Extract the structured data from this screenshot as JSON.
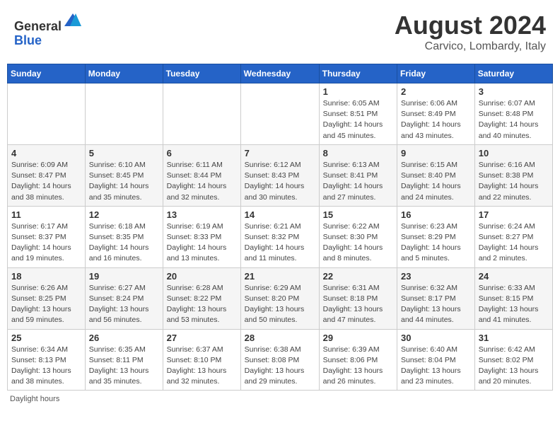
{
  "header": {
    "logo_line1": "General",
    "logo_line2": "Blue",
    "main_title": "August 2024",
    "subtitle": "Carvico, Lombardy, Italy"
  },
  "days_of_week": [
    "Sunday",
    "Monday",
    "Tuesday",
    "Wednesday",
    "Thursday",
    "Friday",
    "Saturday"
  ],
  "weeks": [
    [
      {
        "day": "",
        "detail": ""
      },
      {
        "day": "",
        "detail": ""
      },
      {
        "day": "",
        "detail": ""
      },
      {
        "day": "",
        "detail": ""
      },
      {
        "day": "1",
        "detail": "Sunrise: 6:05 AM\nSunset: 8:51 PM\nDaylight: 14 hours\nand 45 minutes."
      },
      {
        "day": "2",
        "detail": "Sunrise: 6:06 AM\nSunset: 8:49 PM\nDaylight: 14 hours\nand 43 minutes."
      },
      {
        "day": "3",
        "detail": "Sunrise: 6:07 AM\nSunset: 8:48 PM\nDaylight: 14 hours\nand 40 minutes."
      }
    ],
    [
      {
        "day": "4",
        "detail": "Sunrise: 6:09 AM\nSunset: 8:47 PM\nDaylight: 14 hours\nand 38 minutes."
      },
      {
        "day": "5",
        "detail": "Sunrise: 6:10 AM\nSunset: 8:45 PM\nDaylight: 14 hours\nand 35 minutes."
      },
      {
        "day": "6",
        "detail": "Sunrise: 6:11 AM\nSunset: 8:44 PM\nDaylight: 14 hours\nand 32 minutes."
      },
      {
        "day": "7",
        "detail": "Sunrise: 6:12 AM\nSunset: 8:43 PM\nDaylight: 14 hours\nand 30 minutes."
      },
      {
        "day": "8",
        "detail": "Sunrise: 6:13 AM\nSunset: 8:41 PM\nDaylight: 14 hours\nand 27 minutes."
      },
      {
        "day": "9",
        "detail": "Sunrise: 6:15 AM\nSunset: 8:40 PM\nDaylight: 14 hours\nand 24 minutes."
      },
      {
        "day": "10",
        "detail": "Sunrise: 6:16 AM\nSunset: 8:38 PM\nDaylight: 14 hours\nand 22 minutes."
      }
    ],
    [
      {
        "day": "11",
        "detail": "Sunrise: 6:17 AM\nSunset: 8:37 PM\nDaylight: 14 hours\nand 19 minutes."
      },
      {
        "day": "12",
        "detail": "Sunrise: 6:18 AM\nSunset: 8:35 PM\nDaylight: 14 hours\nand 16 minutes."
      },
      {
        "day": "13",
        "detail": "Sunrise: 6:19 AM\nSunset: 8:33 PM\nDaylight: 14 hours\nand 13 minutes."
      },
      {
        "day": "14",
        "detail": "Sunrise: 6:21 AM\nSunset: 8:32 PM\nDaylight: 14 hours\nand 11 minutes."
      },
      {
        "day": "15",
        "detail": "Sunrise: 6:22 AM\nSunset: 8:30 PM\nDaylight: 14 hours\nand 8 minutes."
      },
      {
        "day": "16",
        "detail": "Sunrise: 6:23 AM\nSunset: 8:29 PM\nDaylight: 14 hours\nand 5 minutes."
      },
      {
        "day": "17",
        "detail": "Sunrise: 6:24 AM\nSunset: 8:27 PM\nDaylight: 14 hours\nand 2 minutes."
      }
    ],
    [
      {
        "day": "18",
        "detail": "Sunrise: 6:26 AM\nSunset: 8:25 PM\nDaylight: 13 hours\nand 59 minutes."
      },
      {
        "day": "19",
        "detail": "Sunrise: 6:27 AM\nSunset: 8:24 PM\nDaylight: 13 hours\nand 56 minutes."
      },
      {
        "day": "20",
        "detail": "Sunrise: 6:28 AM\nSunset: 8:22 PM\nDaylight: 13 hours\nand 53 minutes."
      },
      {
        "day": "21",
        "detail": "Sunrise: 6:29 AM\nSunset: 8:20 PM\nDaylight: 13 hours\nand 50 minutes."
      },
      {
        "day": "22",
        "detail": "Sunrise: 6:31 AM\nSunset: 8:18 PM\nDaylight: 13 hours\nand 47 minutes."
      },
      {
        "day": "23",
        "detail": "Sunrise: 6:32 AM\nSunset: 8:17 PM\nDaylight: 13 hours\nand 44 minutes."
      },
      {
        "day": "24",
        "detail": "Sunrise: 6:33 AM\nSunset: 8:15 PM\nDaylight: 13 hours\nand 41 minutes."
      }
    ],
    [
      {
        "day": "25",
        "detail": "Sunrise: 6:34 AM\nSunset: 8:13 PM\nDaylight: 13 hours\nand 38 minutes."
      },
      {
        "day": "26",
        "detail": "Sunrise: 6:35 AM\nSunset: 8:11 PM\nDaylight: 13 hours\nand 35 minutes."
      },
      {
        "day": "27",
        "detail": "Sunrise: 6:37 AM\nSunset: 8:10 PM\nDaylight: 13 hours\nand 32 minutes."
      },
      {
        "day": "28",
        "detail": "Sunrise: 6:38 AM\nSunset: 8:08 PM\nDaylight: 13 hours\nand 29 minutes."
      },
      {
        "day": "29",
        "detail": "Sunrise: 6:39 AM\nSunset: 8:06 PM\nDaylight: 13 hours\nand 26 minutes."
      },
      {
        "day": "30",
        "detail": "Sunrise: 6:40 AM\nSunset: 8:04 PM\nDaylight: 13 hours\nand 23 minutes."
      },
      {
        "day": "31",
        "detail": "Sunrise: 6:42 AM\nSunset: 8:02 PM\nDaylight: 13 hours\nand 20 minutes."
      }
    ]
  ],
  "footer_text": "Daylight hours"
}
